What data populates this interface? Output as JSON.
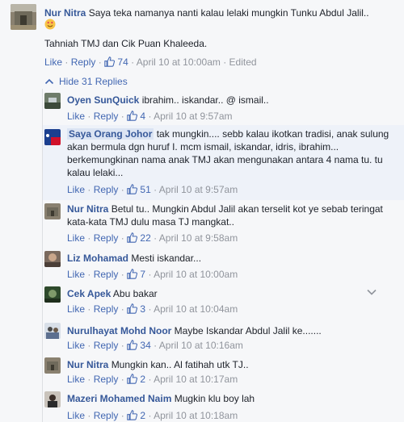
{
  "top_comment": {
    "author": "Nur Nitra",
    "text_line1": "Saya teka namanya nanti kalau lelaki mungkin Tunku Abdul Jalil..",
    "text_line2": "Tahniah TMJ dan Cik Puan Khaleeda.",
    "like": "Like",
    "reply": "Reply",
    "likes": "74",
    "timestamp": "April 10 at 10:00am",
    "edited": "Edited"
  },
  "hide_replies": "Hide 31 Replies",
  "replies": [
    {
      "author": "Oyen SunQuick",
      "text": "ibrahim.. iskandar.. @ ismail..",
      "likes": "4",
      "timestamp": "April 10 at 9:57am"
    },
    {
      "author": "Saya Orang Johor",
      "text": "tak mungkin.... sebb kalau ikotkan tradisi, anak sulung akan bermula dgn huruf I. mcm ismail, iskandar, idris, ibrahim... berkemungkinan nama anak TMJ akan mengunakan antara 4 nama tu. tu kalau lelaki...",
      "likes": "51",
      "timestamp": "April 10 at 9:57am"
    },
    {
      "author": "Nur Nitra",
      "text": "Betul tu.. Mungkin Abdul Jalil akan terselit kot ye sebab teringat kata-kata TMJ dulu masa TJ mangkat..",
      "likes": "22",
      "timestamp": "April 10 at 9:58am"
    },
    {
      "author": "Liz Mohamad",
      "text": "Mesti iskandar...",
      "likes": "7",
      "timestamp": "April 10 at 10:00am"
    },
    {
      "author": "Cek Apek",
      "text": "Abu bakar",
      "likes": "3",
      "timestamp": "April 10 at 10:04am"
    },
    {
      "author": "Nurulhayat Mohd Noor",
      "text": "Maybe Iskandar Abdul Jalil ke.......",
      "likes": "34",
      "timestamp": "April 10 at 10:16am"
    },
    {
      "author": "Nur Nitra",
      "text": "Mungkin kan.. Al fatihah utk TJ..",
      "likes": "2",
      "timestamp": "April 10 at 10:17am"
    },
    {
      "author": "Mazeri Mohamed Naim",
      "text": "Mugkin klu boy lah",
      "likes": "2",
      "timestamp": "April 10 at 10:18am"
    }
  ],
  "labels": {
    "like": "Like",
    "reply": "Reply",
    "dot": "·"
  },
  "colors": {
    "link": "#365899",
    "action": "#4267b2",
    "meta": "#90949c",
    "background": "#f6f7f9"
  }
}
